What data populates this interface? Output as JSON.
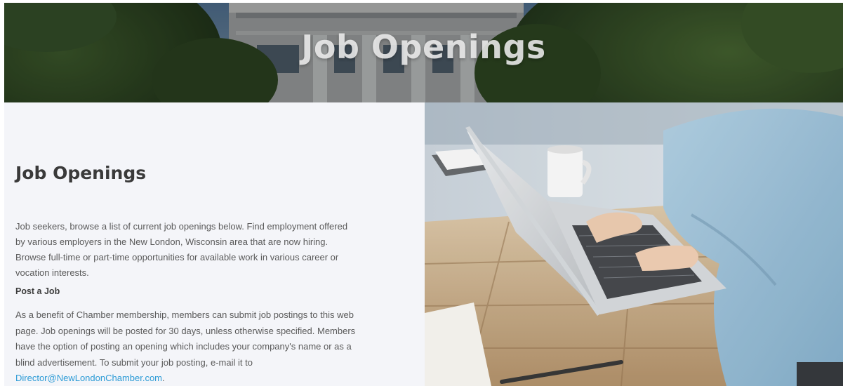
{
  "hero": {
    "title": "Job Openings"
  },
  "main": {
    "title": "Job Openings",
    "intro": "Job seekers, browse a list of current job openings below. Find employment offered by various employers in the New London, Wisconsin area that are now hiring. Browse full-time or part-time opportunities for available work in various career or vocation interests.",
    "post_heading": "Post a Job",
    "benefit_text": "As a benefit of Chamber membership, members can submit job postings to this web page.  Job openings will be posted for 30 days, unless otherwise specified. Members have the option of posting an opening which includes your company's name or as a blind advertisement.  To submit your job posting, e-mail it to ",
    "email_link": "Director@NewLondonChamber.com",
    "benefit_end": "."
  },
  "colors": {
    "link": "#2c9bd6",
    "content_bg": "#f4f5f9",
    "heading": "#3a3a3a",
    "body_text": "#5a5a5a"
  },
  "images": {
    "hero": "building-columns-trees-photo",
    "side": "person-typing-on-laptop-photo"
  }
}
